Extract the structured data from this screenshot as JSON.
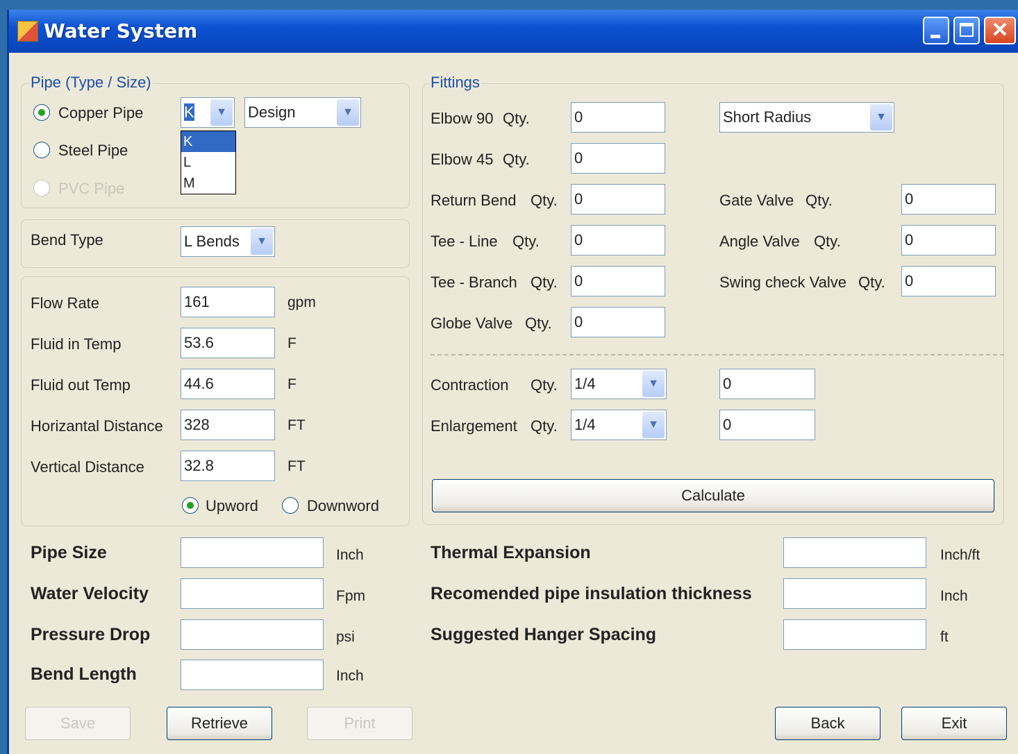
{
  "window": {
    "title": "Water System"
  },
  "pipe_group": {
    "label": "Pipe (Type / Size)",
    "copper": "Copper Pipe",
    "steel": "Steel Pipe",
    "pvc": "PVC Pipe",
    "selected": "Copper Pipe",
    "type_value": "K",
    "type_options": [
      "K",
      "L",
      "M"
    ],
    "mode_value": "Design"
  },
  "bend": {
    "label": "Bend Type",
    "value": "L Bends"
  },
  "inputs": {
    "flow_rate": {
      "label": "Flow Rate",
      "value": "161",
      "unit": "gpm"
    },
    "fluid_in": {
      "label": "Fluid in Temp",
      "value": "53.6",
      "unit": "F"
    },
    "fluid_out": {
      "label": "Fluid out Temp",
      "value": "44.6",
      "unit": "F"
    },
    "horizontal": {
      "label": "Horizantal Distance",
      "value": "328",
      "unit": "FT"
    },
    "vertical": {
      "label": "Vertical Distance",
      "value": "32.8",
      "unit": "FT"
    },
    "upward": "Upword",
    "downward": "Downword",
    "direction_selected": "Upword"
  },
  "fittings": {
    "label": "Fittings",
    "elbow90": {
      "label": "Elbow 90",
      "qty": "Qty.",
      "value": "0"
    },
    "elbow45": {
      "label": "Elbow 45",
      "qty": "Qty.",
      "value": "0"
    },
    "return_bend": {
      "label": "Return Bend",
      "qty": "Qty.",
      "value": "0"
    },
    "tee_line": {
      "label": "Tee - Line",
      "qty": "Qty.",
      "value": "0"
    },
    "tee_branch": {
      "label": "Tee - Branch",
      "qty": "Qty.",
      "value": "0"
    },
    "globe_valve": {
      "label": "Globe Valve",
      "qty": "Qty.",
      "value": "0"
    },
    "radius": "Short Radius",
    "gate_valve": {
      "label": "Gate Valve",
      "qty": "Qty.",
      "value": "0"
    },
    "angle_valve": {
      "label": "Angle Valve",
      "qty": "Qty.",
      "value": "0"
    },
    "swing_check": {
      "label": "Swing check Valve",
      "qty": "Qty.",
      "value": "0"
    },
    "contraction": {
      "label": "Contraction",
      "qty": "Qty.",
      "ratio": "1/4",
      "value": "0"
    },
    "enlargement": {
      "label": "Enlargement",
      "qty": "Qty.",
      "ratio": "1/4",
      "value": "0"
    },
    "calculate": "Calculate"
  },
  "results": {
    "pipe_size": {
      "label": "Pipe Size",
      "value": "",
      "unit": "Inch"
    },
    "water_velocity": {
      "label": "Water Velocity",
      "value": "",
      "unit": "Fpm"
    },
    "pressure_drop": {
      "label": "Pressure Drop",
      "value": "",
      "unit": "psi"
    },
    "bend_length": {
      "label": "Bend Length",
      "value": "",
      "unit": "Inch"
    },
    "thermal": {
      "label": "Thermal Expansion",
      "value": "",
      "unit": "Inch/ft"
    },
    "insulation": {
      "label": "Recomended pipe insulation thickness",
      "value": "",
      "unit": "Inch"
    },
    "hanger": {
      "label": "Suggested Hanger Spacing",
      "value": "",
      "unit": "ft"
    }
  },
  "buttons": {
    "save": "Save",
    "retrieve": "Retrieve",
    "print": "Print",
    "back": "Back",
    "exit": "Exit"
  }
}
